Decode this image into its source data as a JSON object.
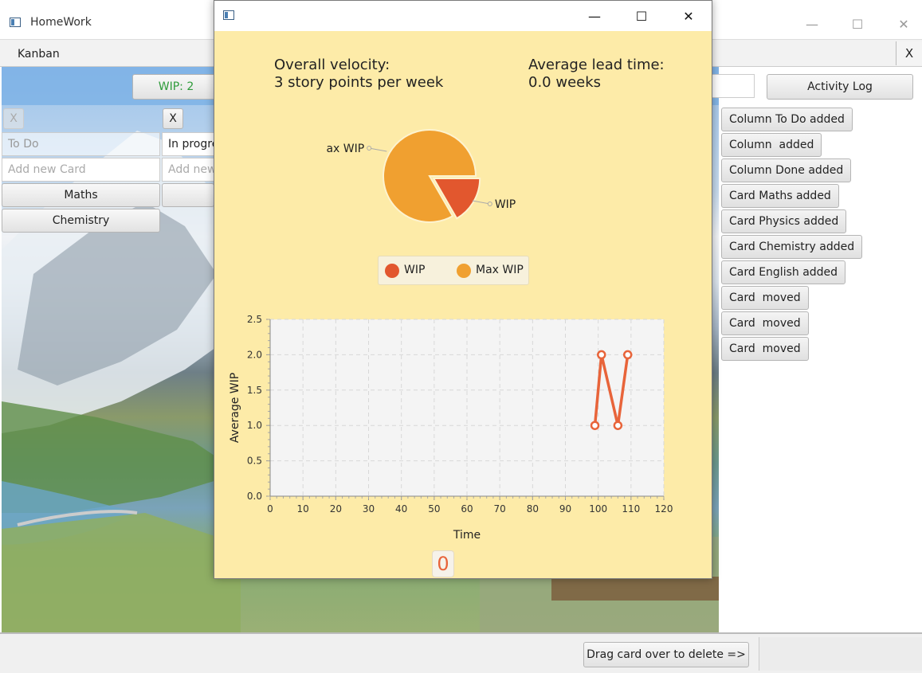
{
  "main_window": {
    "title": "HomeWork",
    "menu_label": "Kanban",
    "menu_close": "X",
    "wip_button": "WIP: 2",
    "activity_log_button": "Activity Log",
    "columns": [
      {
        "close": "X",
        "name": "To Do",
        "add_placeholder": "Add new Card",
        "cards": [
          "Maths",
          "Chemistry"
        ]
      },
      {
        "close": "X",
        "name": "In progress",
        "add_placeholder": "Add new Card",
        "cards": [
          ""
        ]
      }
    ],
    "activity_log": [
      "Column To Do added",
      "Column  added",
      "Column Done added",
      "Card Maths added",
      "Card Physics added",
      "Card Chemistry added",
      "Card English added",
      "Card  moved",
      "Card  moved",
      "Card  moved"
    ],
    "delete_button": "Drag card over to delete =>"
  },
  "window_controls": {
    "minimize": "—",
    "maximize": "☐",
    "close": "✕"
  },
  "dialog": {
    "velocity_label": "Overall velocity:",
    "velocity_value": "3 story points per week",
    "lead_time_label": "Average lead time:",
    "lead_time_value": "0.0 weeks",
    "zero_badge": "0"
  },
  "colors": {
    "wip": "#e2572e",
    "max_wip": "#f0a030",
    "dialog_bg": "#fdeba8",
    "line": "#e8643a"
  },
  "chart_data": [
    {
      "type": "pie",
      "slices": [
        {
          "label": "WIP",
          "value": 2
        },
        {
          "label": "Max WIP",
          "value": 10
        }
      ],
      "legend": [
        "WIP",
        "Max WIP"
      ],
      "legend_position": "bottom"
    },
    {
      "type": "line",
      "xlabel": "Time",
      "ylabel": "Average WIP",
      "xlim": [
        0,
        120
      ],
      "ylim": [
        0,
        2.5
      ],
      "x_ticks": [
        0,
        10,
        20,
        30,
        40,
        50,
        60,
        70,
        80,
        90,
        100,
        110,
        120
      ],
      "y_ticks": [
        "0.0",
        "0.5",
        "1.0",
        "1.5",
        "2.0",
        "2.5"
      ],
      "grid": true,
      "series": [
        {
          "x": [
            99,
            101,
            106,
            109
          ],
          "y": [
            1.0,
            2.0,
            1.0,
            2.0
          ]
        }
      ]
    }
  ]
}
